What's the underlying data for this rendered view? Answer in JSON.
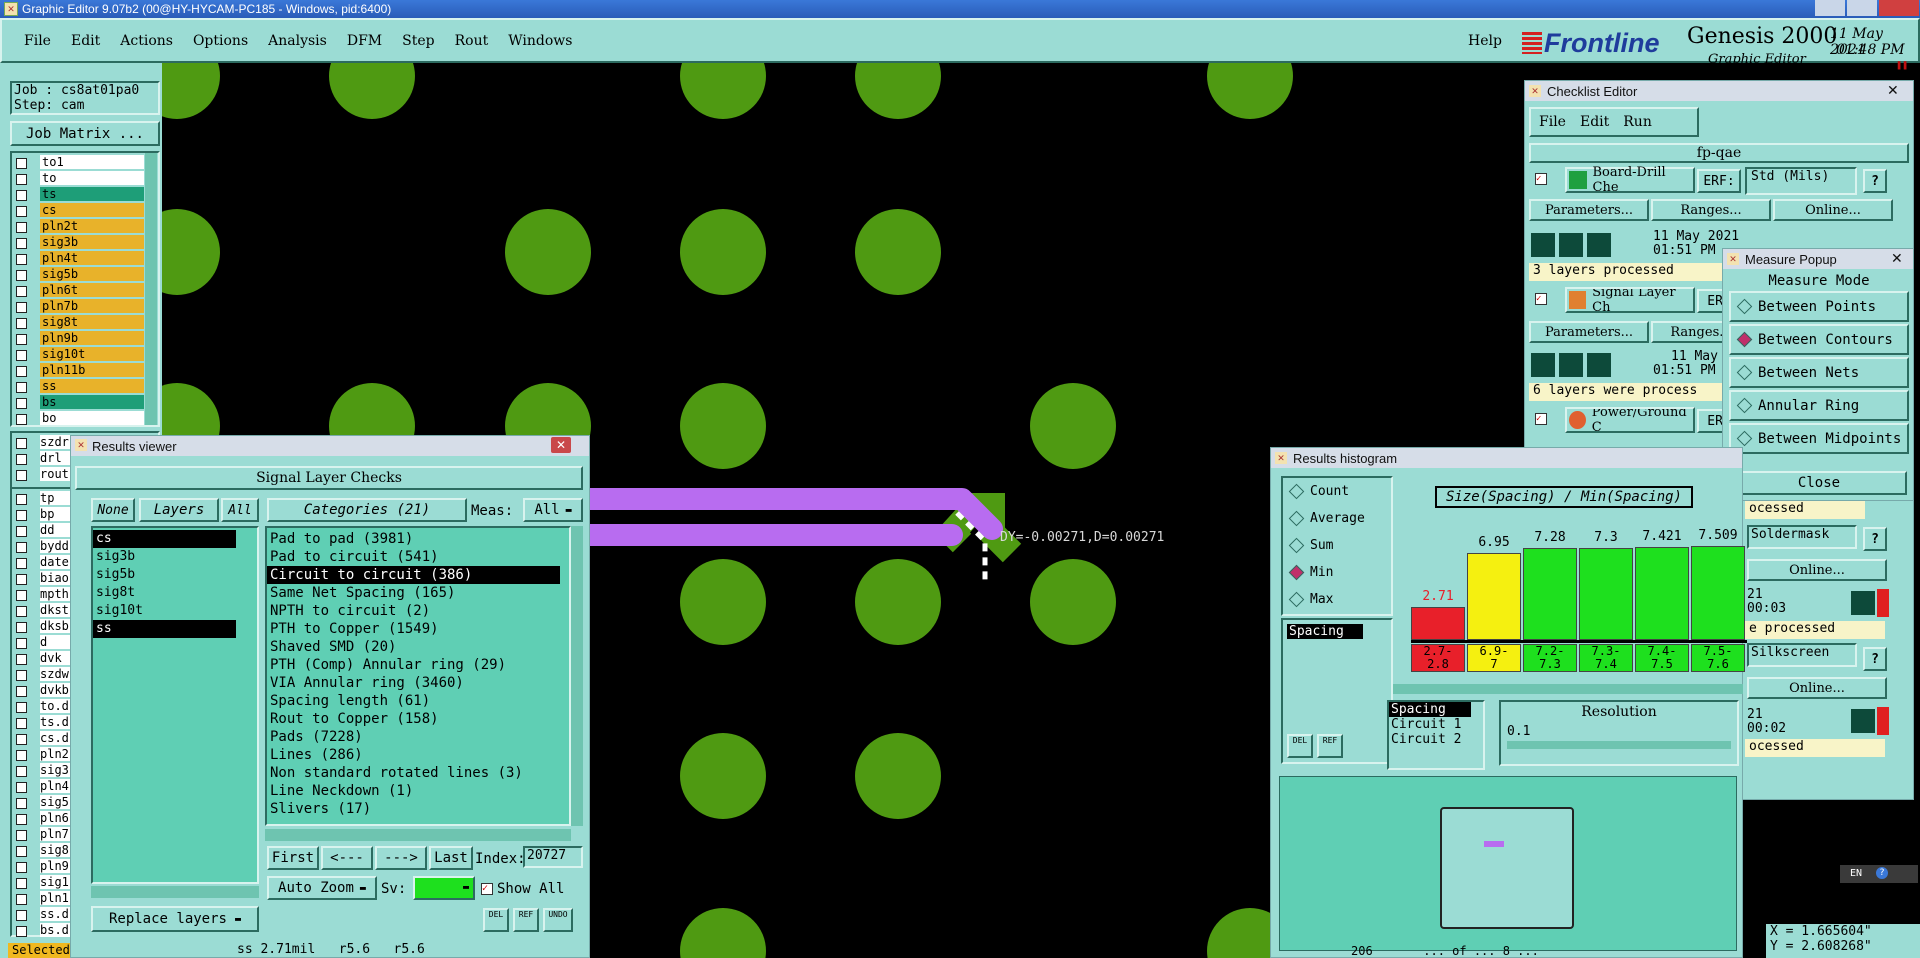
{
  "window": {
    "title": "Graphic Editor 9.07b2 (00@HY-HYCAM-PC185 - Windows, pid:6400)"
  },
  "menubar": {
    "items": [
      "File",
      "Edit",
      "Actions",
      "Options",
      "Analysis",
      "DFM",
      "Step",
      "Rout",
      "Windows"
    ],
    "help": "Help"
  },
  "brand": {
    "logo": "Frontline",
    "product": "Genesis 2000",
    "subtitle": "Graphic Editor",
    "date": "11 May 2021",
    "time": "01:48 PM"
  },
  "job": {
    "job_label": "Job : cs8at01pa0",
    "step_label": "Step: cam",
    "matrix_button": "Job Matrix ..."
  },
  "layers": [
    {
      "name": "to1",
      "color": "#ffffff"
    },
    {
      "name": "to",
      "color": "#ffffff"
    },
    {
      "name": "ts",
      "color": "#1e9e78"
    },
    {
      "name": "cs",
      "color": "#e8b22a"
    },
    {
      "name": "pln2t",
      "color": "#e8b22a"
    },
    {
      "name": "sig3b",
      "color": "#e8b22a"
    },
    {
      "name": "pln4t",
      "color": "#e8b22a"
    },
    {
      "name": "sig5b",
      "color": "#e8b22a"
    },
    {
      "name": "pln6t",
      "color": "#e8b22a"
    },
    {
      "name": "pln7b",
      "color": "#e8b22a"
    },
    {
      "name": "sig8t",
      "color": "#e8b22a"
    },
    {
      "name": "pln9b",
      "color": "#e8b22a"
    },
    {
      "name": "sig10t",
      "color": "#e8b22a"
    },
    {
      "name": "pln11b",
      "color": "#e8b22a"
    },
    {
      "name": "ss",
      "color": "#e8b22a"
    },
    {
      "name": "bs",
      "color": "#1e9e78"
    },
    {
      "name": "bo",
      "color": "#ffffff"
    }
  ],
  "layers2": [
    "szdr",
    "drl",
    "rout"
  ],
  "layers3": [
    "tp",
    "bp",
    "dd",
    "bydd",
    "date",
    "biao",
    "mpth",
    "dkst",
    "dksb",
    "d",
    "dvk",
    "szdw",
    "dvkb",
    "to.d",
    "ts.d",
    "cs.d",
    "pln2",
    "sig3",
    "pln4",
    "sig5",
    "pln6",
    "pln7",
    "sig8",
    "pln9",
    "sig1",
    "pln1",
    "ss.d",
    "bs.d"
  ],
  "status": {
    "selected": "Selected",
    "info": "ss 2.71mil   r5.6   r5.6"
  },
  "canvas": {
    "measure_label": "DY=-0.00271,D=0.00271"
  },
  "results_viewer": {
    "title": "Results viewer",
    "heading": "Signal Layer Checks",
    "none": "None",
    "layers_tab": "Layers",
    "all": "All",
    "layer_list": [
      "cs",
      "sig3b",
      "sig5b",
      "sig8t",
      "sig10t",
      "ss"
    ],
    "categories_tab": "Categories (21)",
    "meas_label": "Meas:",
    "meas_value": "All",
    "categories": [
      "Pad to pad (3981)",
      "Pad to circuit (541)",
      "Circuit to circuit (386)",
      "Same Net Spacing (165)",
      "NPTH to circuit (2)",
      "PTH to Copper (1549)",
      "Shaved SMD (20)",
      "PTH (Comp) Annular ring (29)",
      "VIA Annular ring (3460)",
      "Spacing length (61)",
      "Rout to Copper (158)",
      "Pads (7228)",
      "Lines (286)",
      "Non standard rotated lines (3)",
      "Line Neckdown (1)",
      "Slivers (17)"
    ],
    "first": "First",
    "prev": "<---",
    "next": "--->",
    "last": "Last",
    "index_label": "Index:",
    "index_value": "20727",
    "replace_layers": "Replace layers",
    "auto_zoom": "Auto Zoom",
    "sv_label": "Sv:",
    "show_all": "Show All",
    "del": "DEL",
    "ref": "REF",
    "undo": "UNDO"
  },
  "checklist": {
    "title": "Checklist Editor",
    "menu": [
      "File",
      "Edit",
      "Run"
    ],
    "name": "fp-qae",
    "check1": {
      "name": "Board-Drill Che",
      "erf": "ERF:",
      "units": "Std (Mils)",
      "date": "11 May 2021",
      "time": "01:51 PM",
      "status": "3 layers processed"
    },
    "check2": {
      "name": "Signal Layer Ch",
      "erf": "ERF",
      "date": "11 May",
      "time": "01:51 PM -",
      "status": "6 layers were process"
    },
    "check3": {
      "name": "Power/Ground C",
      "erf": "ERI"
    },
    "parameters": "Parameters...",
    "ranges": "Ranges...",
    "online": "Online...",
    "right": {
      "processed1": "ocessed",
      "soldermask": "Soldermask",
      "time1": "00:03",
      "processed2": "e processed",
      "silkscreen": "Silkscreen",
      "time2": "00:02",
      "processed3": "ocessed",
      "year": "21"
    }
  },
  "measure_popup": {
    "title": "Measure Popup",
    "heading": "Measure Mode",
    "options": [
      "Between Points",
      "Between Contours",
      "Between Nets",
      "Annular Ring",
      "Between Midpoints"
    ],
    "selected": 1,
    "close": "Close"
  },
  "histogram": {
    "title": "Results histogram",
    "options": [
      "Count",
      "Average",
      "Sum",
      "Min",
      "Max"
    ],
    "selected": 3,
    "header": "Size(Spacing) / Min(Spacing)",
    "list": [
      "Spacing"
    ],
    "bins": [
      {
        "value": "2.71",
        "range": "2.7-\n2.8",
        "color": "#e8202a"
      },
      {
        "value": "6.95",
        "range": "6.9-\n7",
        "color": "#f5f010"
      },
      {
        "value": "7.28",
        "range": "7.2-\n7.3",
        "color": "#1ee01e"
      },
      {
        "value": "7.3",
        "range": "7.3-\n7.4",
        "color": "#1ee01e"
      },
      {
        "value": "7.421",
        "range": "7.4-\n7.5",
        "color": "#1ee01e"
      },
      {
        "value": "7.509",
        "range": "7.5-\n7.6",
        "color": "#1ee01e"
      }
    ],
    "bar_heights": [
      0.33,
      0.87,
      0.92,
      0.92,
      0.93,
      0.94
    ],
    "list2": [
      "Spacing",
      "Circuit 1",
      "Circuit 2"
    ],
    "resolution_label": "Resolution",
    "resolution_value": "0.1",
    "del": "DEL",
    "ref": "REF",
    "footer": "206       ... of ... 8 ..."
  },
  "coords": {
    "x": "X = 1.665604\"",
    "y": "Y = 2.608268\""
  },
  "tray": {
    "lang": "EN"
  }
}
